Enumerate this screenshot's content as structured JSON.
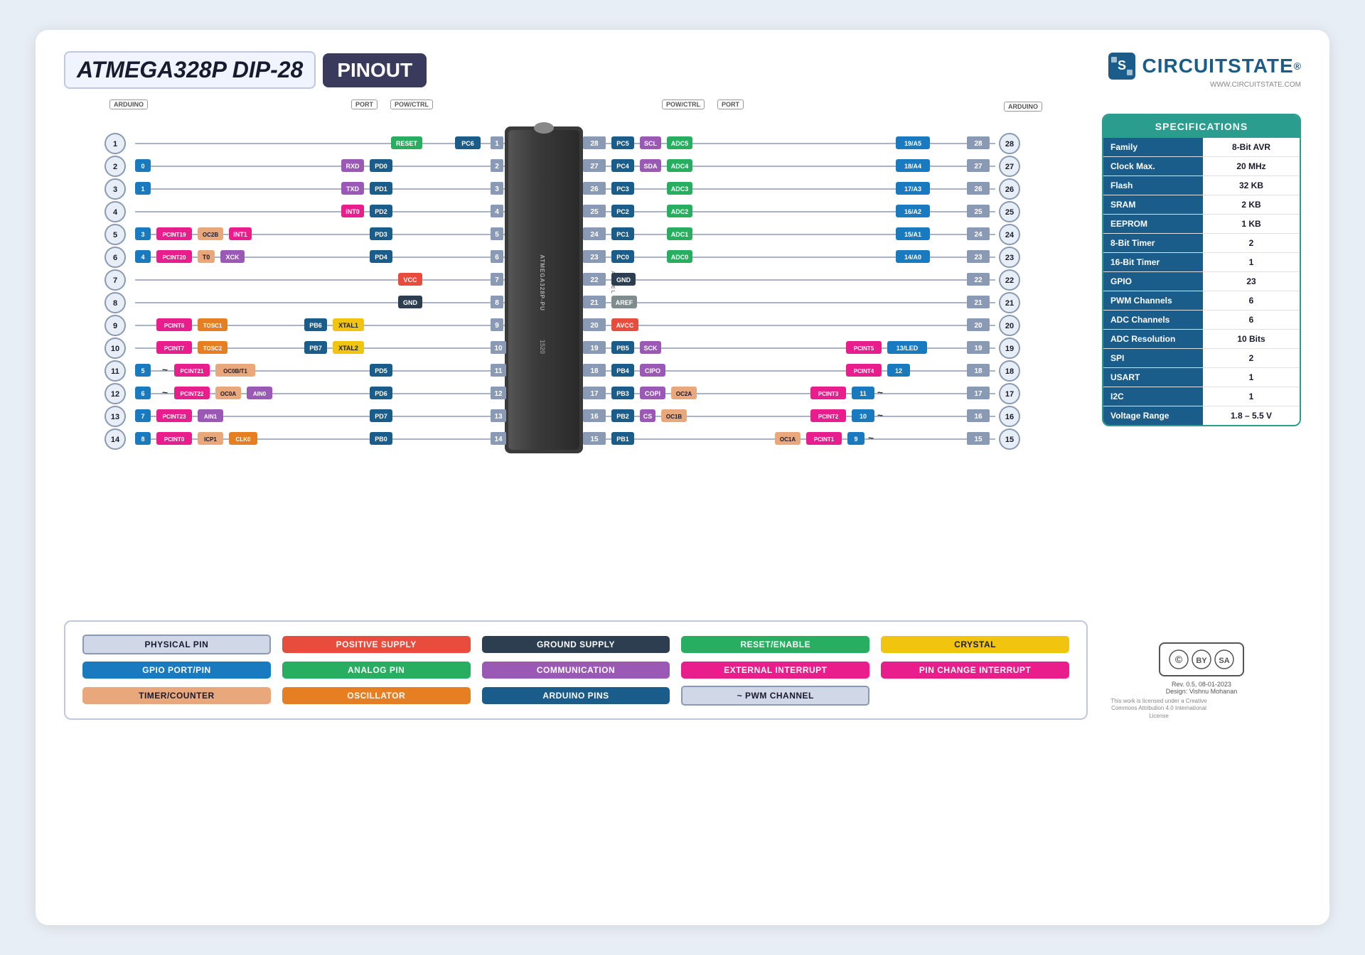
{
  "header": {
    "title_chip": "ATMEGA328P DIP-28",
    "title_pinout": "PINOUT",
    "logo_text": "CIRCUITSTATE",
    "logo_sub": "WWW.CIRCUITSTATE.COM",
    "reg_symbol": "®"
  },
  "specs": {
    "header": "SPECIFICATIONS",
    "rows": [
      {
        "label": "Family",
        "value": "8-Bit AVR"
      },
      {
        "label": "Clock Max.",
        "value": "20 MHz"
      },
      {
        "label": "Flash",
        "value": "32 KB"
      },
      {
        "label": "SRAM",
        "value": "2 KB"
      },
      {
        "label": "EEPROM",
        "value": "1 KB"
      },
      {
        "label": "8-Bit Timer",
        "value": "2"
      },
      {
        "label": "16-Bit Timer",
        "value": "1"
      },
      {
        "label": "GPIO",
        "value": "23"
      },
      {
        "label": "PWM Channels",
        "value": "6"
      },
      {
        "label": "ADC Channels",
        "value": "6"
      },
      {
        "label": "ADC Resolution",
        "value": "10 Bits"
      },
      {
        "label": "SPI",
        "value": "2"
      },
      {
        "label": "USART",
        "value": "1"
      },
      {
        "label": "I2C",
        "value": "1"
      },
      {
        "label": "Voltage Range",
        "value": "1.8 – 5.5 V"
      }
    ]
  },
  "legend": {
    "items": [
      {
        "label": "PHYSICAL PIN",
        "color": "#d0d8e8",
        "textColor": "#1a1a2e",
        "border": "2px solid #8a9ab5"
      },
      {
        "label": "POSITIVE SUPPLY",
        "color": "#e74c3c",
        "textColor": "white",
        "border": "none"
      },
      {
        "label": "GROUND SUPPLY",
        "color": "#2c3e50",
        "textColor": "white",
        "border": "none"
      },
      {
        "label": "RESET/ENABLE",
        "color": "#27ae60",
        "textColor": "white",
        "border": "none"
      },
      {
        "label": "CRYSTAL",
        "color": "#f1c40f",
        "textColor": "#1a1a2e",
        "border": "none"
      },
      {
        "label": "GPIO PORT/PIN",
        "color": "#1a7abf",
        "textColor": "white",
        "border": "none"
      },
      {
        "label": "ANALOG PIN",
        "color": "#27ae60",
        "textColor": "white",
        "border": "none"
      },
      {
        "label": "COMMUNICATION",
        "color": "#9b59b6",
        "textColor": "white",
        "border": "none"
      },
      {
        "label": "EXTERNAL INTERRUPT",
        "color": "#e91e8c",
        "textColor": "white",
        "border": "none"
      },
      {
        "label": "PIN CHANGE INTERRUPT",
        "color": "#e91e8c",
        "textColor": "white",
        "border": "none"
      },
      {
        "label": "TIMER/COUNTER",
        "color": "#e8a87c",
        "textColor": "#1a1a2e",
        "border": "none"
      },
      {
        "label": "OSCILLATOR",
        "color": "#e67e22",
        "textColor": "white",
        "border": "none"
      },
      {
        "label": "ARDUINO PINS",
        "color": "#1a5c8a",
        "textColor": "white",
        "border": "none"
      },
      {
        "label": "~ PWM CHANNEL",
        "color": "#d0d8e8",
        "textColor": "#1a1a2e",
        "border": "2px solid #8a9ab5"
      }
    ]
  },
  "pins_left": [
    {
      "num": 1,
      "port": "PC6",
      "ctrl": "RESET",
      "arduino": null,
      "extra": []
    },
    {
      "num": 2,
      "port": "PD0",
      "ctrl": null,
      "arduino": "0",
      "extra": [
        "RXD"
      ]
    },
    {
      "num": 3,
      "port": "PD1",
      "ctrl": null,
      "arduino": "1",
      "extra": [
        "TXD"
      ]
    },
    {
      "num": 4,
      "port": "PD2",
      "ctrl": null,
      "arduino": null,
      "extra": [
        "INT0"
      ]
    },
    {
      "num": 5,
      "port": "PD3",
      "ctrl": null,
      "arduino": "3",
      "extra": [
        "PCINT19",
        "OC2B",
        "INT1"
      ]
    },
    {
      "num": 6,
      "port": "PD4",
      "ctrl": null,
      "arduino": "4",
      "extra": [
        "PCINT20",
        "T0",
        "XCK"
      ]
    },
    {
      "num": 7,
      "port": null,
      "ctrl": "VCC",
      "arduino": null,
      "extra": []
    },
    {
      "num": 8,
      "port": null,
      "ctrl": "GND",
      "arduino": null,
      "extra": []
    },
    {
      "num": 9,
      "port": "PB6",
      "ctrl": null,
      "arduino": null,
      "extra": [
        "PCINT6",
        "TOSC1",
        "XTAL1"
      ]
    },
    {
      "num": 10,
      "port": "PB7",
      "ctrl": null,
      "arduino": null,
      "extra": [
        "PCINT7",
        "TOSC2",
        "XTAL2"
      ]
    },
    {
      "num": 11,
      "port": "PD5",
      "ctrl": null,
      "arduino": "5",
      "extra": [
        "PCINT21",
        "OC0B/T1"
      ]
    },
    {
      "num": 12,
      "port": "PD6",
      "ctrl": null,
      "arduino": "6",
      "extra": [
        "PCINT22",
        "OC0A",
        "AIN0"
      ]
    },
    {
      "num": 13,
      "port": "PD7",
      "ctrl": null,
      "arduino": "7",
      "extra": [
        "PCINT23",
        "AIN1"
      ]
    },
    {
      "num": 14,
      "port": "PB0",
      "ctrl": null,
      "arduino": "8",
      "extra": [
        "PCINT0",
        "ICP1",
        "CLK0"
      ]
    }
  ],
  "pins_right": [
    {
      "num": 28,
      "port": "PC5",
      "adc": "ADC5",
      "arduino": "19/A5",
      "extra": [
        "SCL"
      ]
    },
    {
      "num": 27,
      "port": "PC4",
      "adc": "ADC4",
      "arduino": "18/A4",
      "extra": [
        "SDA"
      ]
    },
    {
      "num": 26,
      "port": "PC3",
      "adc": "ADC3",
      "arduino": "17/A3",
      "extra": []
    },
    {
      "num": 25,
      "port": "PC2",
      "adc": "ADC2",
      "arduino": "16/A2",
      "extra": []
    },
    {
      "num": 24,
      "port": "PC1",
      "adc": "ADC1",
      "arduino": "15/A1",
      "extra": []
    },
    {
      "num": 23,
      "port": "PC0",
      "adc": "ADC0",
      "arduino": "14/A0",
      "extra": []
    },
    {
      "num": 22,
      "port": null,
      "adc": null,
      "arduino": null,
      "extra": [
        "GND"
      ]
    },
    {
      "num": 21,
      "port": null,
      "adc": null,
      "arduino": null,
      "extra": [
        "AREF"
      ]
    },
    {
      "num": 20,
      "port": null,
      "adc": null,
      "arduino": null,
      "extra": [
        "AVCC"
      ]
    },
    {
      "num": 19,
      "port": "PB5",
      "adc": null,
      "arduino": "13/LED",
      "extra": [
        "SCK",
        "PCINT5"
      ]
    },
    {
      "num": 18,
      "port": "PB4",
      "adc": null,
      "arduino": "12",
      "extra": [
        "CIPO",
        "PCINT4"
      ]
    },
    {
      "num": 17,
      "port": "PB3",
      "adc": null,
      "arduino": "11",
      "extra": [
        "COPI",
        "OC2A",
        "PCINT3"
      ]
    },
    {
      "num": 16,
      "port": "PB2",
      "adc": null,
      "arduino": "10",
      "extra": [
        "CS",
        "OC1B",
        "PCINT2"
      ]
    },
    {
      "num": 15,
      "port": "PB1",
      "adc": null,
      "arduino": "9",
      "extra": [
        "OC1A",
        "PCINT1"
      ]
    }
  ],
  "ic": {
    "text1": "ATMEL",
    "text2": "ATMEGA328P-PU",
    "text3": "1520"
  },
  "cc": {
    "rev": "Rev. 0.5, 08-01-2023",
    "design": "Design: Vishnu Mohanan",
    "license": "CC BY SA"
  }
}
